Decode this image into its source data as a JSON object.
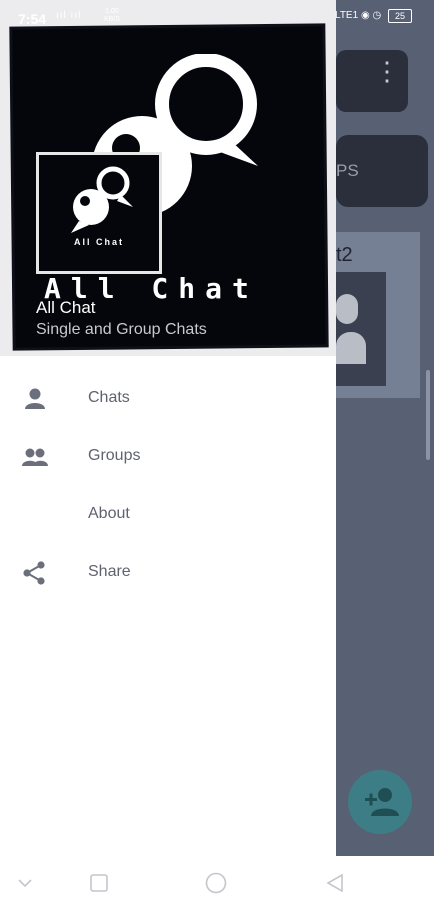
{
  "status_bar": {
    "time": "7:54",
    "network": "ııl ııl",
    "speed_value": "1.00",
    "speed_unit": "KB/S",
    "right_icons": "LTE1 ◉ ◷",
    "battery": "25"
  },
  "background": {
    "tab_partial": "PS",
    "card_title_partial": "t2"
  },
  "drawer": {
    "header": {
      "brand_wordmark": "All Chat",
      "logo_small_text": "All Chat",
      "app_name": "All Chat",
      "subtitle": "Single and Group Chats"
    },
    "menu": [
      {
        "label": "Chats",
        "icon": "person-icon"
      },
      {
        "label": "Groups",
        "icon": "group-icon"
      },
      {
        "label": "About",
        "icon": ""
      },
      {
        "label": "Share",
        "icon": "share-icon"
      }
    ]
  },
  "colors": {
    "drawer_bg": "#ffffff",
    "header_bg": "#05060c",
    "scrim_bg": "#586074",
    "fab_bg": "#3d7e86",
    "menu_text": "#5f6370",
    "menu_icon": "#6b6f7c"
  }
}
